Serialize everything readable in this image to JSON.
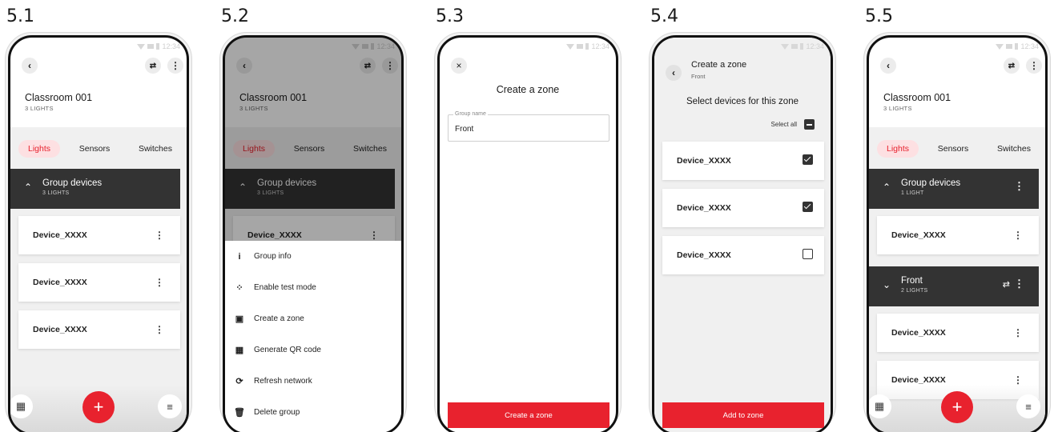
{
  "steps": [
    {
      "label": "5.1"
    },
    {
      "label": "5.2"
    },
    {
      "label": "5.3"
    },
    {
      "label": "5.4"
    },
    {
      "label": "5.5"
    }
  ],
  "status_time": "12:34",
  "room": {
    "title": "Classroom 001",
    "subtitle": "3 LIGHTS"
  },
  "tabs": {
    "lights": "Lights",
    "sensors": "Sensors",
    "switches": "Switches"
  },
  "group": {
    "name": "Group devices",
    "sub_3": "3 LIGHTS",
    "sub_1": "1 LIGHT"
  },
  "device": "Device_XXXX",
  "menu": [
    {
      "icon": "i",
      "label": "Group info"
    },
    {
      "icon": "⁘",
      "label": "Enable test mode"
    },
    {
      "icon": "▣",
      "label": "Create a zone"
    },
    {
      "icon": "▦",
      "label": "Generate QR code"
    },
    {
      "icon": "⟳",
      "label": "Refresh network"
    },
    {
      "icon": "🗑",
      "label": "Delete group"
    }
  ],
  "create_zone": {
    "title": "Create a zone",
    "field_label": "Group name",
    "field_value": "Front",
    "button": "Create a zone"
  },
  "select_zone": {
    "title": "Create a zone",
    "subtitle": "Front",
    "heading": "Select devices for this zone",
    "select_all": "Select all",
    "button": "Add to zone",
    "checked": [
      true,
      true,
      false
    ]
  },
  "zone": {
    "name": "Front",
    "sub": "2 LIGHTS"
  },
  "icons": {
    "plus": "+",
    "menu": "≡",
    "building": "▦",
    "back": "‹",
    "close": "×"
  },
  "colors": {
    "accent": "#e8222e",
    "dark_header": "#333333"
  }
}
